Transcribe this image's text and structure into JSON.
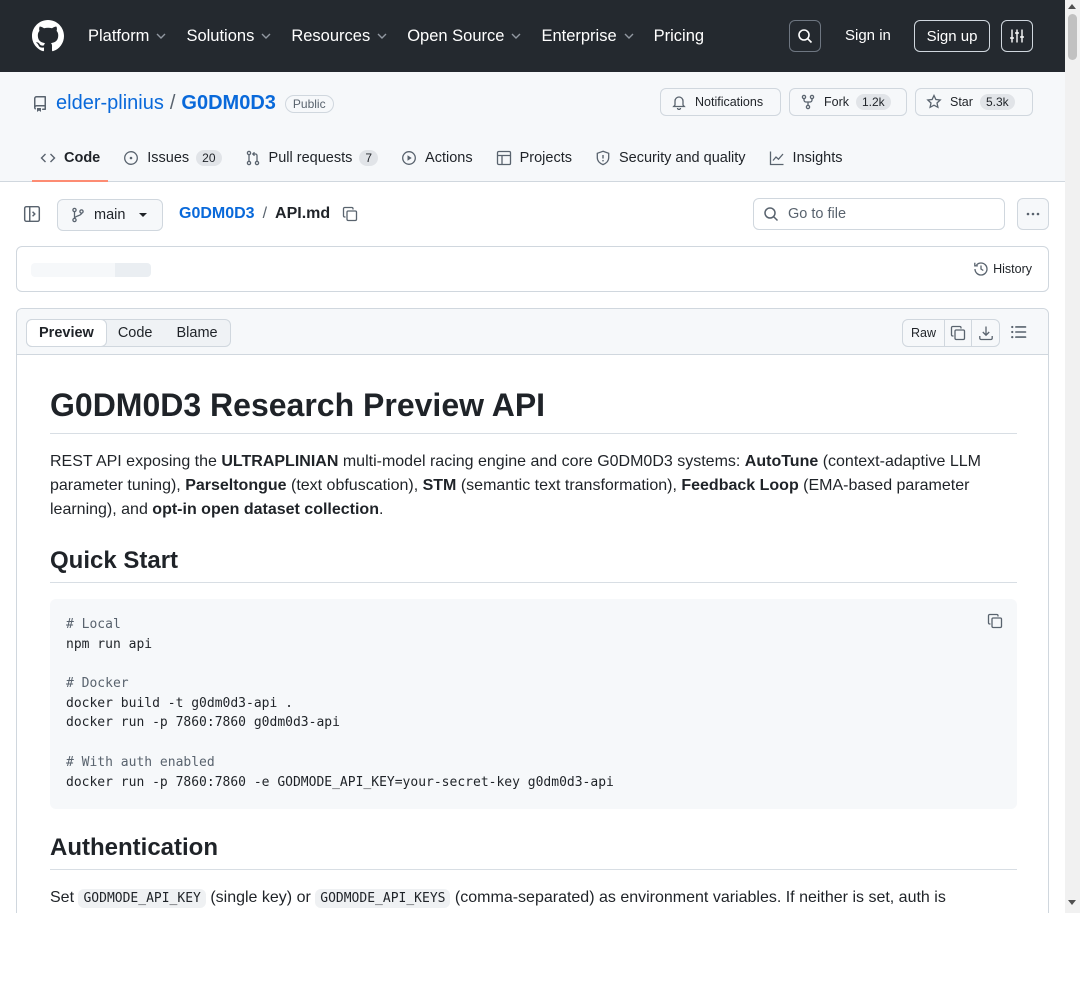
{
  "header": {
    "nav": [
      {
        "label": "Platform",
        "has_menu": true
      },
      {
        "label": "Solutions",
        "has_menu": true
      },
      {
        "label": "Resources",
        "has_menu": true
      },
      {
        "label": "Open Source",
        "has_menu": true
      },
      {
        "label": "Enterprise",
        "has_menu": true
      },
      {
        "label": "Pricing",
        "has_menu": false
      }
    ],
    "sign_in": "Sign in",
    "sign_up": "Sign up"
  },
  "repo": {
    "owner": "elder-plinius",
    "name": "G0DM0D3",
    "visibility": "Public",
    "notifications_label": "Notifications",
    "fork_label": "Fork",
    "fork_count": "1.2k",
    "star_label": "Star",
    "star_count": "5.3k",
    "tabs": [
      {
        "label": "Code",
        "count": "",
        "icon": "code-icon",
        "active": true
      },
      {
        "label": "Issues",
        "count": "20",
        "icon": "issue-icon",
        "active": false
      },
      {
        "label": "Pull requests",
        "count": "7",
        "icon": "pull-request-icon",
        "active": false
      },
      {
        "label": "Actions",
        "count": "",
        "icon": "play-icon",
        "active": false
      },
      {
        "label": "Projects",
        "count": "",
        "icon": "table-icon",
        "active": false
      },
      {
        "label": "Security and quality",
        "count": "",
        "icon": "shield-icon",
        "active": false
      },
      {
        "label": "Insights",
        "count": "",
        "icon": "graph-icon",
        "active": false
      }
    ]
  },
  "filebar": {
    "branch": "main",
    "repo_crumb": "G0DM0D3",
    "separator": "/",
    "file_name": "API.md",
    "goto_placeholder": "Go to file"
  },
  "commit": {
    "history_label": "History"
  },
  "viewer": {
    "modes": [
      "Preview",
      "Code",
      "Blame"
    ],
    "active_mode": "Preview",
    "raw_label": "Raw"
  },
  "markdown": {
    "h1": "G0DM0D3 Research Preview API",
    "intro": [
      {
        "t": "REST API exposing the ",
        "b": false
      },
      {
        "t": "ULTRAPLINIAN",
        "b": true
      },
      {
        "t": " multi-model racing engine and core G0DM0D3 systems: ",
        "b": false
      },
      {
        "t": "AutoTune",
        "b": true
      },
      {
        "t": " (context-adaptive LLM parameter tuning), ",
        "b": false
      },
      {
        "t": "Parseltongue",
        "b": true
      },
      {
        "t": " (text obfuscation), ",
        "b": false
      },
      {
        "t": "STM",
        "b": true
      },
      {
        "t": " (semantic text transformation), ",
        "b": false
      },
      {
        "t": "Feedback Loop",
        "b": true
      },
      {
        "t": " (EMA-based parameter learning), and ",
        "b": false
      },
      {
        "t": "opt-in open dataset collection",
        "b": true
      },
      {
        "t": ".",
        "b": false
      }
    ],
    "h2_quick": "Quick Start",
    "code_lines": [
      {
        "text": "# Local",
        "comment": true
      },
      {
        "text": "npm run api",
        "comment": false
      },
      {
        "text": "",
        "comment": false
      },
      {
        "text": "# Docker",
        "comment": true
      },
      {
        "text": "docker build -t g0dm0d3-api .",
        "comment": false
      },
      {
        "text": "docker run -p 7860:7860 g0dm0d3-api",
        "comment": false
      },
      {
        "text": "",
        "comment": false
      },
      {
        "text": "# With auth enabled",
        "comment": true
      },
      {
        "text": "docker run -p 7860:7860 -e GODMODE_API_KEY=your-secret-key g0dm0d3-api",
        "comment": false
      }
    ],
    "h2_auth": "Authentication",
    "auth_p": {
      "pre": "Set ",
      "code1": "GODMODE_API_KEY",
      "mid": " (single key) or ",
      "code2": "GODMODE_API_KEYS",
      "post": " (comma-separated) as environment variables. If neither is set, auth is"
    }
  }
}
